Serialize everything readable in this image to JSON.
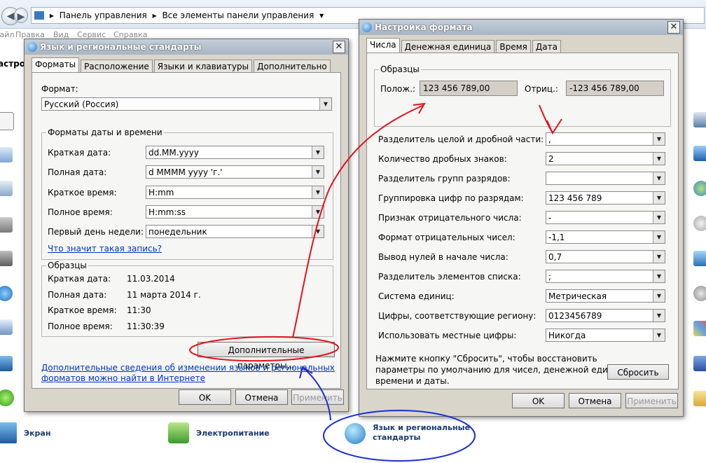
{
  "explorer": {
    "breadcrumb": [
      "Панель управления",
      "Все элементы панели управления"
    ],
    "menu": [
      "Файл",
      "Правка",
      "Вид",
      "Сервис",
      "Справка"
    ],
    "left_partial_text": "астрой",
    "items": [
      {
        "label": "Экран"
      },
      {
        "label": "Электропитание"
      },
      {
        "label": "Язык и региональные стандарты"
      }
    ]
  },
  "region_dialog": {
    "title": "Язык и региональные стандарты",
    "tabs": [
      "Форматы",
      "Расположение",
      "Языки и клавиатуры",
      "Дополнительно"
    ],
    "format_label": "Формат:",
    "format_value": "Русский (Россия)",
    "datetime_group": "Форматы даты и времени",
    "rows": [
      {
        "label": "Краткая дата:",
        "value": "dd.MM.yyyy"
      },
      {
        "label": "Полная дата:",
        "value": "d MMMM yyyy 'г.'"
      },
      {
        "label": "Краткое время:",
        "value": "H:mm"
      },
      {
        "label": "Полное время:",
        "value": "H:mm:ss"
      },
      {
        "label": "Первый день недели:",
        "value": "понедельник"
      }
    ],
    "help_link": "Что значит такая запись?",
    "samples_group": "Образцы",
    "samples": [
      {
        "label": "Краткая дата:",
        "value": "11.03.2014"
      },
      {
        "label": "Полная дата:",
        "value": "11 марта 2014 г."
      },
      {
        "label": "Краткое время:",
        "value": "11:30"
      },
      {
        "label": "Полное время:",
        "value": "11:30:39"
      }
    ],
    "advanced_button": "Дополнительные параметры...",
    "info_link_1": "Дополнительные сведения об изменении языков и региональных",
    "info_link_2": "форматов можно найти в Интернете",
    "ok": "OK",
    "cancel": "Отмена",
    "apply": "Применить"
  },
  "format_dialog": {
    "title": "Настройка формата",
    "tabs": [
      "Числа",
      "Денежная единица",
      "Время",
      "Дата"
    ],
    "samples_group": "Образцы",
    "positive_label": "Полож.:",
    "positive_value": "123 456 789,00",
    "negative_label": "Отриц.:",
    "negative_value": "-123 456 789,00",
    "rows": [
      {
        "label": "Разделитель целой и дробной части:",
        "value": ","
      },
      {
        "label": "Количество дробных знаков:",
        "value": "2"
      },
      {
        "label": "Разделитель групп разрядов:",
        "value": ""
      },
      {
        "label": "Группировка цифр по разрядам:",
        "value": "123 456 789"
      },
      {
        "label": "Признак отрицательного числа:",
        "value": "-"
      },
      {
        "label": "Формат отрицательных чисел:",
        "value": "-1,1"
      },
      {
        "label": "Вывод нулей в начале числа:",
        "value": "0,7"
      },
      {
        "label": "Разделитель элементов списка:",
        "value": ";"
      },
      {
        "label": "Система единиц:",
        "value": "Метрическая"
      },
      {
        "label": "Цифры, соответствующие региону:",
        "value": "0123456789"
      },
      {
        "label": "Использовать местные цифры:",
        "value": "Никогда"
      }
    ],
    "reset_text_1": "Нажмите кнопку \"Сбросить\", чтобы восстановить",
    "reset_text_2": "параметры по умолчанию для чисел, денежной единицы,",
    "reset_text_3": "времени и даты.",
    "reset_button": "Сбросить",
    "ok": "OK",
    "cancel": "Отмена",
    "apply": "Применить"
  },
  "colors": {
    "annotation_red": "#e3121b",
    "annotation_blue": "#1b2fd4",
    "dialog_bg": "#d9d5cb",
    "link": "#0033cc"
  }
}
